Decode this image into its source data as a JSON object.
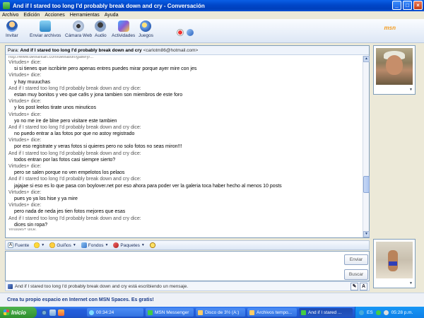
{
  "window": {
    "title": "And if I stared too long I'd probably break down and cry - Conversación",
    "controls": [
      "_",
      "□",
      "×"
    ]
  },
  "menu": [
    "Archivo",
    "Edición",
    "Acciones",
    "Herramientas",
    "Ayuda"
  ],
  "toolbar": {
    "buttons": [
      "Invitar",
      "Enviar archivos",
      "Cámara Web",
      "Audio",
      "Actividades",
      "Juegos"
    ],
    "logo": "msn"
  },
  "to_line": {
    "prefix": "Para:",
    "name": "And if I stared too long I'd probably break down and cry",
    "email": "<carlotm86@hotmail.com>"
  },
  "history": [
    {
      "role": "partial",
      "text": "http://www.deviantart.com/deviation/gallery/..."
    },
    {
      "role": "sender",
      "text": "Virtudes+ dice:"
    },
    {
      "role": "msg",
      "text": "si si tienes que iscribirte pero apenas entres puedes mirar porque ayer mire con jes"
    },
    {
      "role": "sender",
      "text": "Virtudes+ dice:"
    },
    {
      "role": "msg",
      "text": "y hay muuuchas"
    },
    {
      "role": "sender",
      "text": "And if I stared too long I'd probably break down and cry dice:"
    },
    {
      "role": "msg",
      "text": "estan muy bonitos y veo que ca9s y jona tambien son miembros de este foro"
    },
    {
      "role": "sender",
      "text": "Virtudes+ dice:"
    },
    {
      "role": "msg",
      "text": "y los post leelos tirate unos minuticos"
    },
    {
      "role": "sender",
      "text": "Virtudes+ dice:"
    },
    {
      "role": "msg",
      "text": "yo no me ire de blne pero visitare este tambien"
    },
    {
      "role": "sender",
      "text": "And if I stared too long I'd probably break down and cry dice:"
    },
    {
      "role": "msg",
      "text": "no puedo entrar a las fotos por que no astoy registrado"
    },
    {
      "role": "sender",
      "text": "Virtudes+ dice:"
    },
    {
      "role": "msg",
      "text": "por eso registrate y veras fotos si quieres pero no solo fotos no seas miron!!!"
    },
    {
      "role": "sender",
      "text": "And if I stared too long I'd probably break down and cry dice:"
    },
    {
      "role": "msg",
      "text": "todos entran por las fotos casi siempre sierto?"
    },
    {
      "role": "sender",
      "text": "Virtudes+ dice:"
    },
    {
      "role": "msg",
      "text": "pero se salen porque no ven empelotos los pelaos"
    },
    {
      "role": "sender",
      "text": "And if I stared too long I'd probably break down and cry dice:"
    },
    {
      "role": "msg",
      "text": "jajajae si eso es lo que pasa con boylover.net por eso ahora para poder ver la galeria toca haber hecho al menos 10 posts"
    },
    {
      "role": "sender",
      "text": "Virtudes+ dice:"
    },
    {
      "role": "msg",
      "text": "pues yo ya los hise y ya mire"
    },
    {
      "role": "sender",
      "text": "Virtudes+ dice:"
    },
    {
      "role": "msg",
      "text": "pero nada de neda jes tien fotos mejores que esas"
    },
    {
      "role": "sender",
      "text": "And if I stared too long I'd probably break down and cry dice:"
    },
    {
      "role": "msg",
      "text": "dices sin ropa?"
    },
    {
      "role": "partial",
      "text": "Virtudes+ dice:"
    }
  ],
  "format_bar": [
    "Fuente",
    "Guiños",
    "Fondos",
    "Paquetes"
  ],
  "input": {
    "send_label": "Enviar",
    "search_label": "Buscar"
  },
  "status": {
    "typing": "And if I stared too long I'd probably break down and cry está escribiendo un mensaje.",
    "btn_a": "A"
  },
  "ad": "Crea tu propio espacio en Internet con MSN Spaces. Es gratis!",
  "taskbar": {
    "start": "Inicio",
    "tasks": [
      "00:34:24",
      "MSN Messenger",
      "Disco de 3½ (A:)",
      "Archivos tempo...",
      "And if I stared ..."
    ],
    "tray_lang": "ES",
    "clock": "05:28 p.m."
  }
}
